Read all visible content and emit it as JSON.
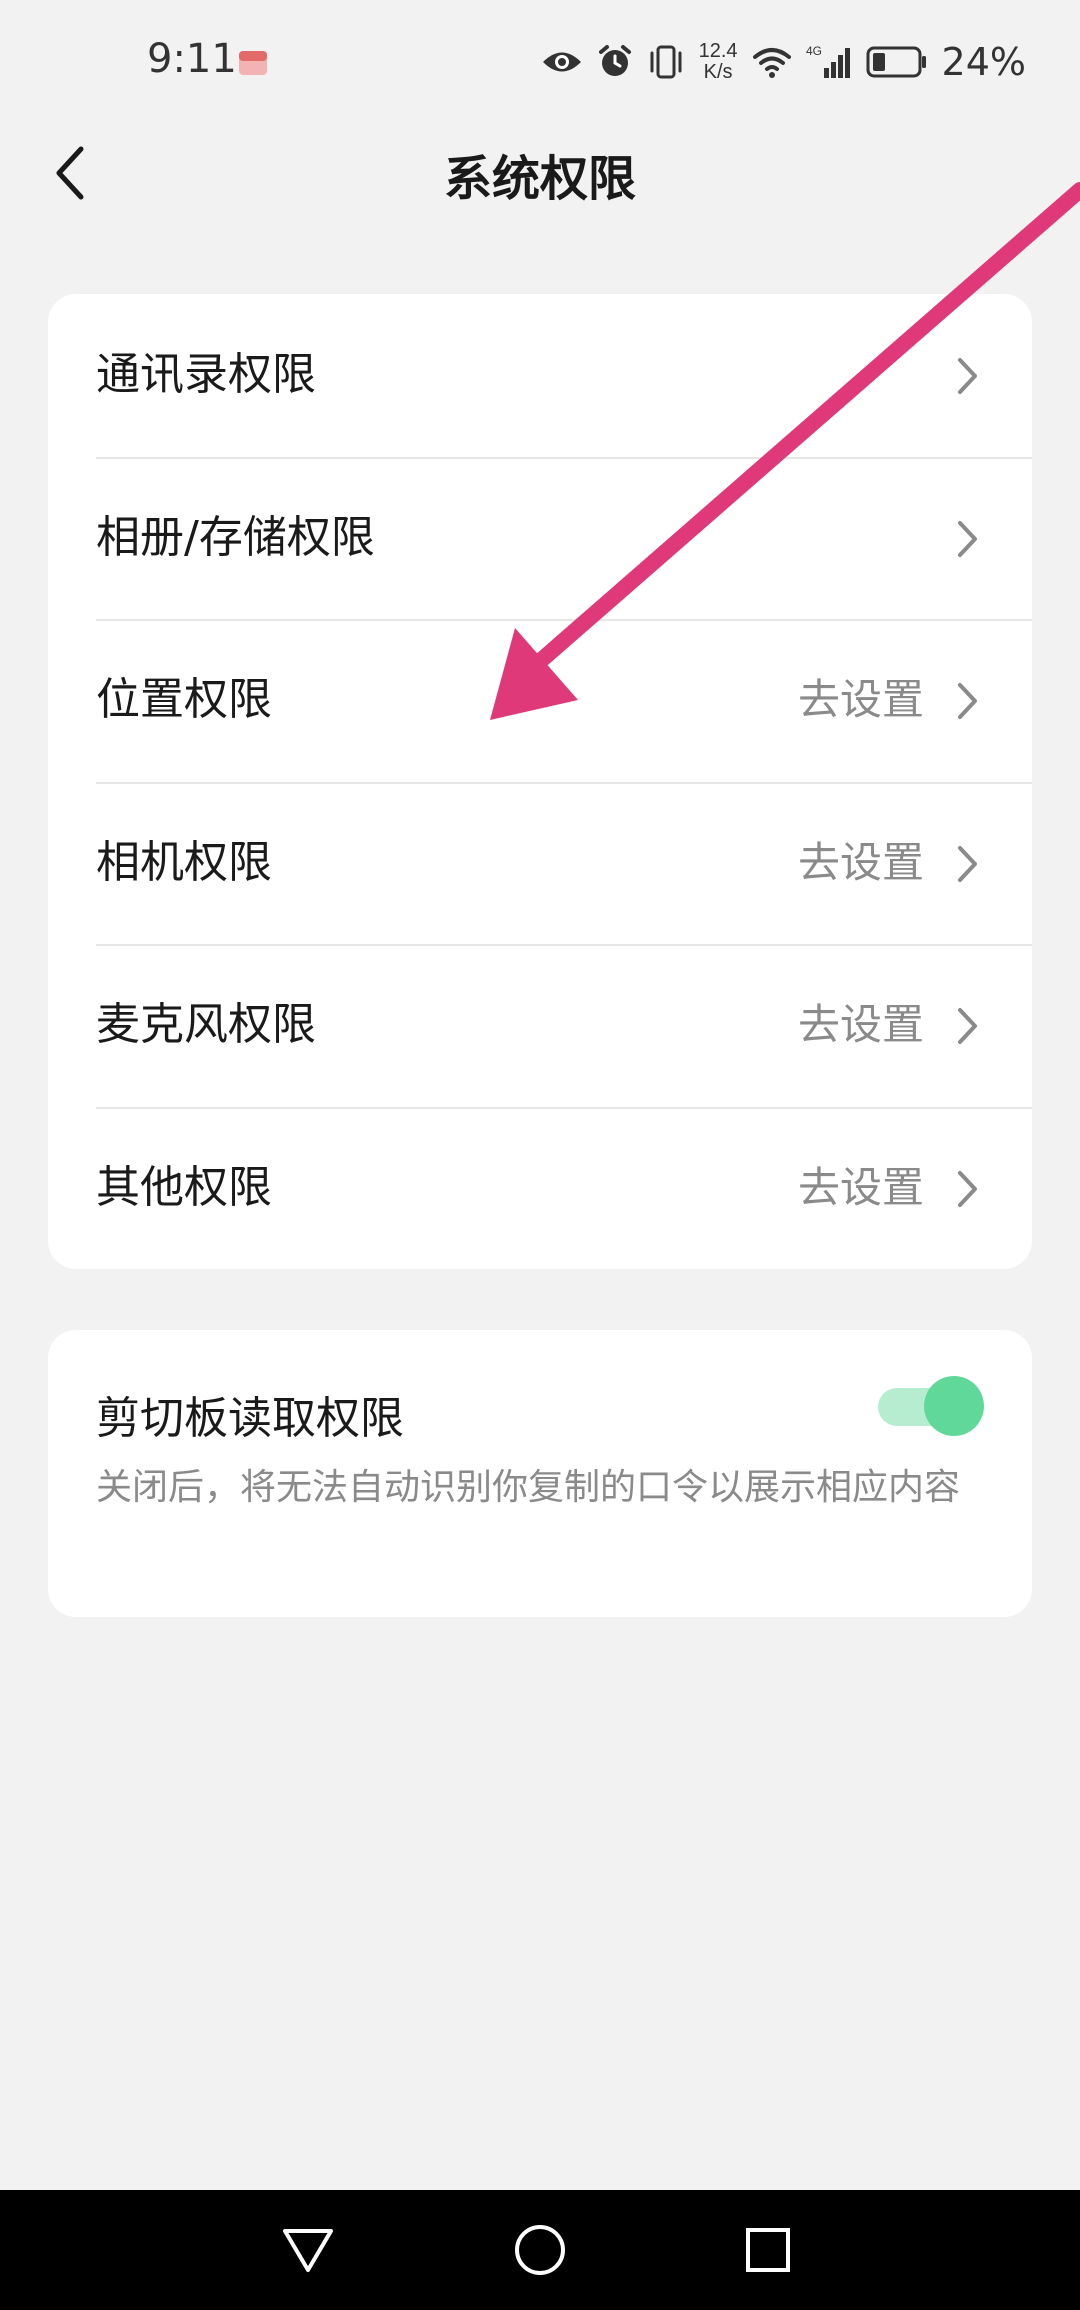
{
  "status_bar": {
    "time": "9:11",
    "net_speed_value": "12.4",
    "net_speed_unit": "K/s",
    "network_type": "4G",
    "battery_percent": "24%",
    "icons": [
      "eye-comfort-icon",
      "alarm-icon",
      "vibrate-icon",
      "wifi-icon",
      "cellular-signal-icon",
      "battery-icon"
    ]
  },
  "header": {
    "title": "系统权限"
  },
  "permissions": [
    {
      "label": "通讯录权限",
      "action": ""
    },
    {
      "label": "相册/存储权限",
      "action": ""
    },
    {
      "label": "位置权限",
      "action": "去设置"
    },
    {
      "label": "相机权限",
      "action": "去设置"
    },
    {
      "label": "麦克风权限",
      "action": "去设置"
    },
    {
      "label": "其他权限",
      "action": "去设置"
    }
  ],
  "clipboard": {
    "title": "剪切板读取权限",
    "description": "关闭后，将无法自动识别你复制的口令以展示相应内容",
    "enabled": true
  },
  "colors": {
    "background": "#f2f2f2",
    "card": "#ffffff",
    "secondary_text": "#8a8a8a",
    "toggle_on": "#5fd89a",
    "annotation_arrow": "#e0397a",
    "nav_bar": "#000000"
  }
}
